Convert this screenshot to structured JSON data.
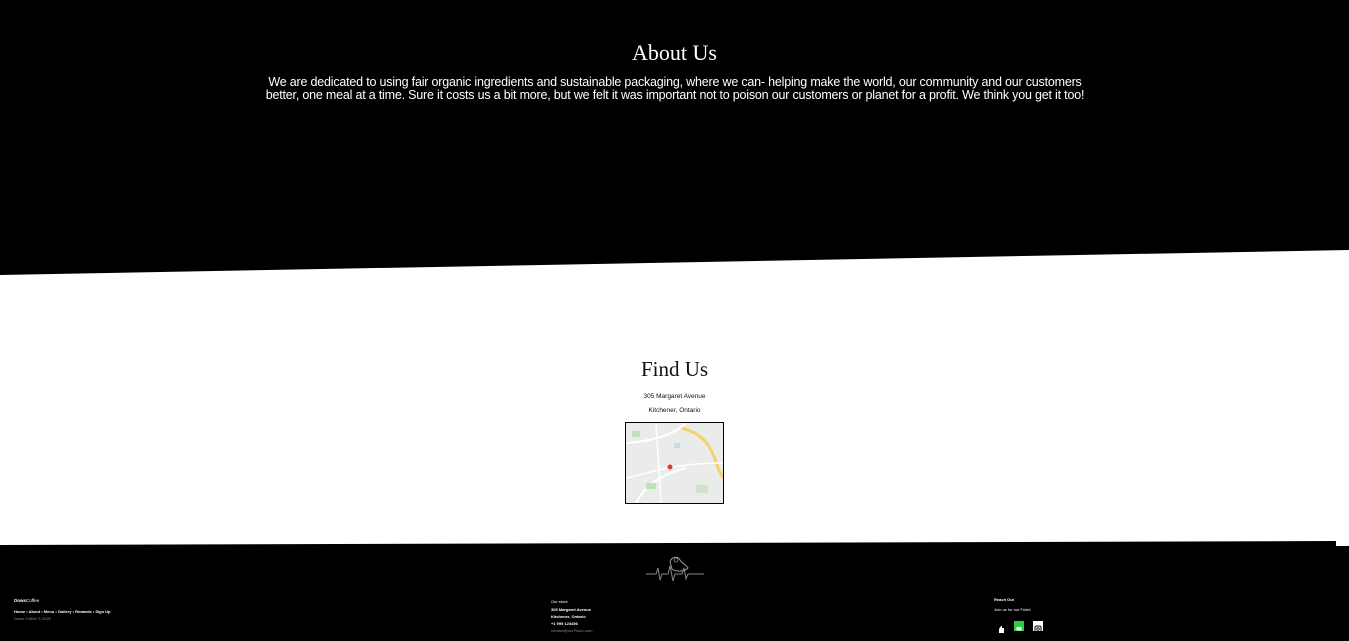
{
  "about": {
    "title": "About Us",
    "text": "We are dedicated to using fair organic ingredients and sustainable packaging, where we can- helping make the world, our community and our customers better, one meal at a time. Sure it costs us a bit more, but we felt it was important not to poison our customers or planet for a profit. We think you get it too!"
  },
  "find": {
    "title": "Find Us",
    "address_line1": "305 Margaret Avenue",
    "address_line2": "Kitchener, Ontario"
  },
  "footer": {
    "brand_bold": "Dows",
    "brand_rest": "Coffee",
    "nav": [
      "Home",
      "About",
      "Menu",
      "Gallery",
      "Rewards",
      "Sign Up"
    ],
    "copyright": "Dows Coffee © 2020",
    "contact_heading": "Our store",
    "contact_street": "305 Margaret Avenue",
    "contact_city": "Kitchener, Ontario",
    "contact_phone": "+1 999 123456",
    "contact_email": "contact@ourPlace.com",
    "social_heading": "Reach Out",
    "social_sub": "Join us for our Fridel",
    "social_icons": [
      "thumbs-up-icon",
      "chat-icon",
      "instagram-icon"
    ]
  },
  "colors": {
    "dark": "#000000",
    "light": "#ffffff",
    "social_green": "#2ecc40"
  }
}
